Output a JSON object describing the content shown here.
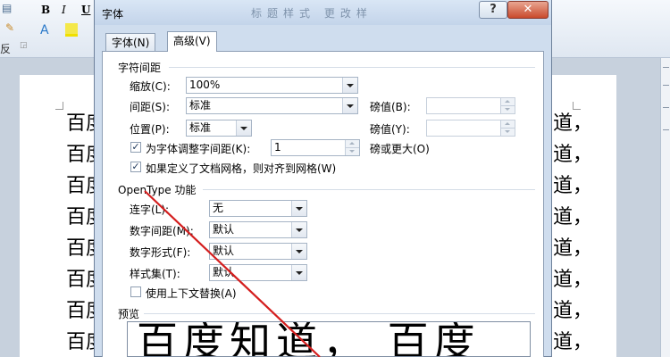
{
  "ribbon": {
    "bold": "B",
    "italic": "I",
    "underline": "U",
    "font_a": "A",
    "fan": "反"
  },
  "document": {
    "left_chars": [
      "百",
      "百",
      "百",
      "百",
      "百",
      "百",
      "百",
      "百"
    ],
    "left_cut": [
      "度",
      "度",
      "度",
      "度",
      "度",
      "度",
      "度",
      "度"
    ],
    "right_lines": [
      "道，",
      "道，",
      "道，",
      "道，",
      "道，",
      "道，",
      "道，",
      "道，"
    ]
  },
  "dialog": {
    "title": "字体",
    "title_ghost": "标题样式 更改样",
    "help": "?",
    "close": "✕",
    "tabs": [
      {
        "label": "字体(N)"
      },
      {
        "label": "高级(V)"
      }
    ],
    "active_tab": 1,
    "spacing_section": "字符间距",
    "scale": {
      "label": "缩放(C):",
      "value": "100%"
    },
    "spacing": {
      "label": "间距(S):",
      "value": "标准",
      "pt_label": "磅值(B):",
      "pt_value": ""
    },
    "position": {
      "label": "位置(P):",
      "value": "标准",
      "pt_label": "磅值(Y):",
      "pt_value": ""
    },
    "kerning": {
      "label": "为字体调整字间距(K):",
      "checked": true,
      "value": "1",
      "suffix": "磅或更大(O)"
    },
    "snap_grid": {
      "label": "如果定义了文档网格，则对齐到网格(W)",
      "checked": true
    },
    "opentype_section": "OpenType 功能",
    "ligatures": {
      "label": "连字(L):",
      "value": "无"
    },
    "num_spacing": {
      "label": "数字间距(M):",
      "value": "默认"
    },
    "num_forms": {
      "label": "数字形式(F):",
      "value": "默认"
    },
    "stylistic_sets": {
      "label": "样式集(T):",
      "value": "默认"
    },
    "contextual_alt": {
      "label": "使用上下文替换(A)",
      "checked": false
    },
    "preview_section": "预览",
    "preview_text": "百度知道， 百度"
  },
  "annotation_color": "#d41e1e"
}
